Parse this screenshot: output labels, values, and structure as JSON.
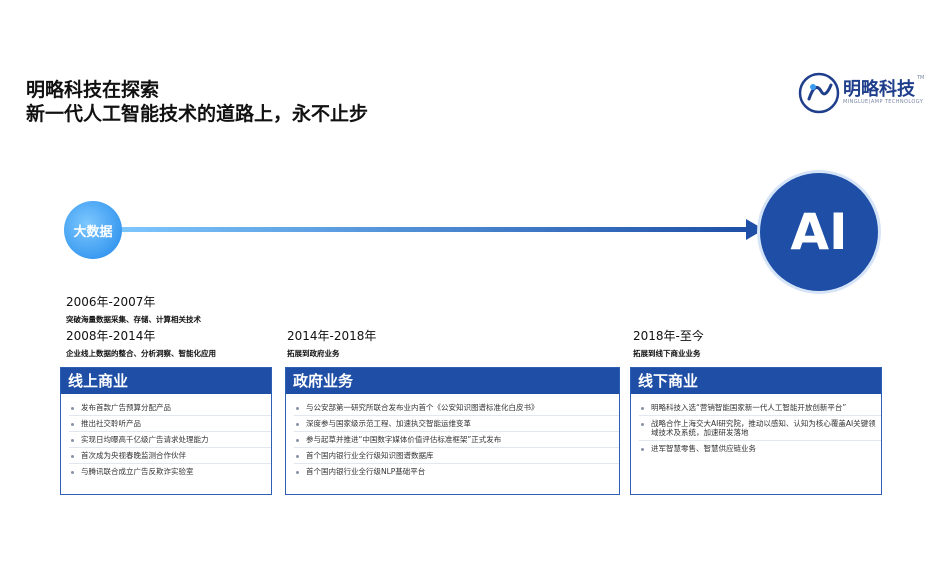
{
  "header": {
    "title_line1": "明略科技在探索",
    "title_line2": "新一代人工智能技术的道路上，永不止步"
  },
  "logo": {
    "name": "明略科技",
    "subtitle": "MINGLUE(AMP TECHNOLOGY",
    "tm": "TM"
  },
  "timeline": {
    "start_label": "大数据",
    "end_label": "AI",
    "accent": "#1e4ea6",
    "start_color": "#3b9bf0"
  },
  "periods": [
    {
      "label": "2006年-2007年",
      "desc": "突破海量数据采集、存储、计算相关技术"
    },
    {
      "label": "2008年-2014年",
      "desc": "企业线上数据的整合、分析洞察、智能化应用"
    },
    {
      "label": "2014年-2018年",
      "desc": "拓展到政府业务"
    },
    {
      "label": "2018年-至今",
      "desc": "拓展到线下商业业务"
    }
  ],
  "cards": [
    {
      "title": "线上商业",
      "items": [
        "发布首款广告预算分配产品",
        "推出社交聆听产品",
        "实现日均曝高千亿级广告请求处理能力",
        "首次成为央视春晚监测合作伙伴",
        "与腾讯联合成立广告反欺诈实验室"
      ]
    },
    {
      "title": "政府业务",
      "items": [
        "与公安部第一研究所联合发布业内首个《公安知识图谱标准化白皮书》",
        "深度参与国家级示范工程、加速执交智能运维变革",
        "参与起草并推进“中国数字媒体价值评估标准框架”正式发布",
        "首个国内银行业全行级知识图谱数据库",
        "首个国内银行业全行级NLP基础平台"
      ]
    },
    {
      "title": "线下商业",
      "items": [
        "明略科技入选“营销智能国家新一代人工智能开放创新平台”",
        "战略合作上海交大AI研究院，推动以感知、认知为核心覆盖AI关键领域技术及系统，加速研发落地",
        "进军智慧零售、智慧供应链业务"
      ]
    }
  ]
}
